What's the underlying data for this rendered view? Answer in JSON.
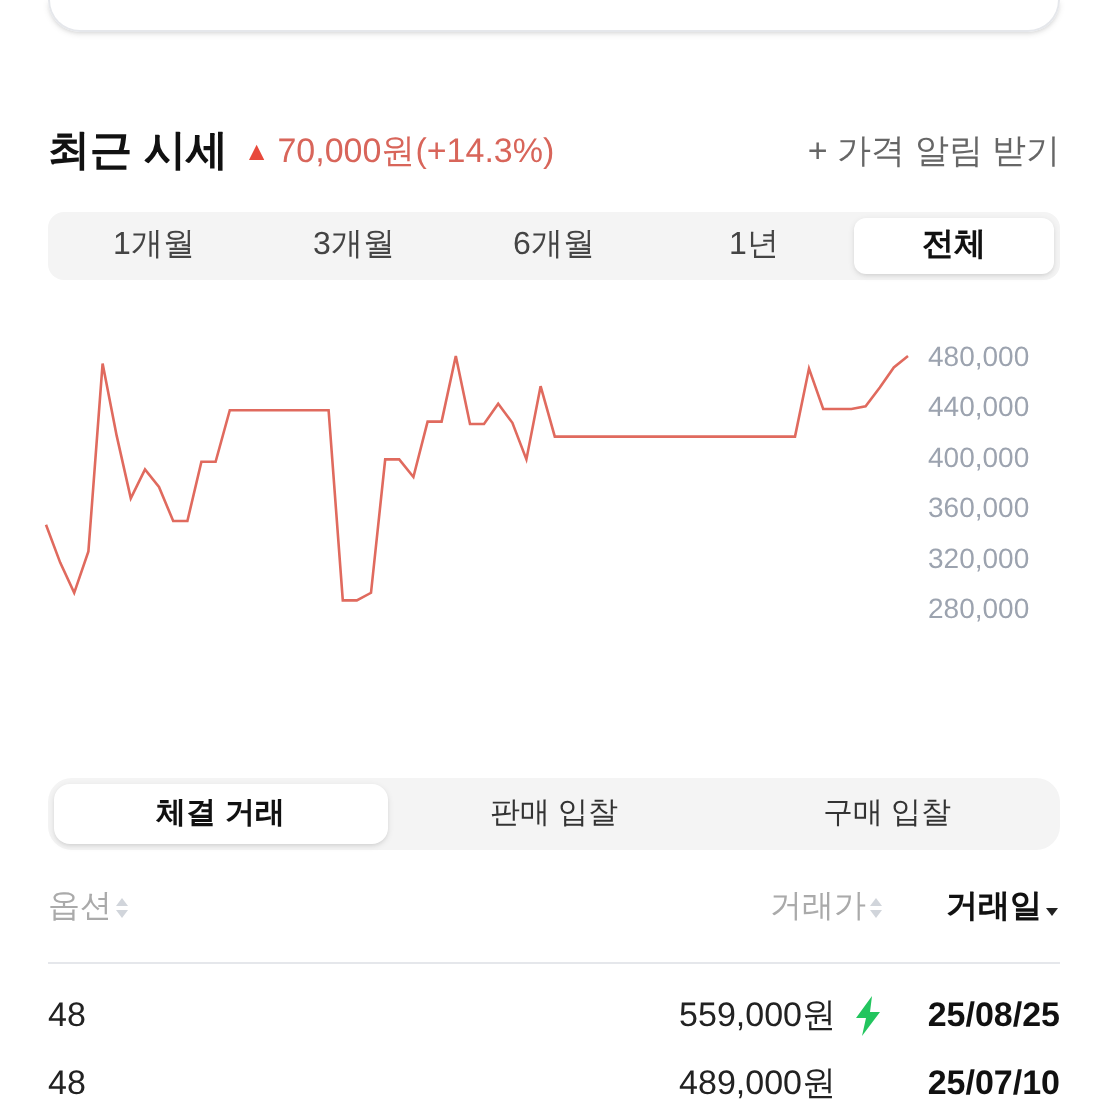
{
  "section": {
    "title": "최근 시세",
    "trend_marker": "▲",
    "change": "70,000원(+14.3%)",
    "alert_link": "+ 가격 알림 받기"
  },
  "period_tabs": [
    {
      "label": "1개월",
      "selected": false
    },
    {
      "label": "3개월",
      "selected": false
    },
    {
      "label": "6개월",
      "selected": false
    },
    {
      "label": "1년",
      "selected": false
    },
    {
      "label": "전체",
      "selected": true
    }
  ],
  "chart_data": {
    "type": "line",
    "ylim": [
      280000,
      480000
    ],
    "yticks": [
      {
        "value": 480000,
        "label": "480,000"
      },
      {
        "value": 440000,
        "label": "440,000"
      },
      {
        "value": 400000,
        "label": "400,000"
      },
      {
        "value": 360000,
        "label": "360,000"
      },
      {
        "value": 320000,
        "label": "320,000"
      },
      {
        "value": 280000,
        "label": "280,000"
      }
    ],
    "categories": [
      null,
      null,
      null,
      null,
      null,
      null,
      null,
      null,
      null,
      null,
      null,
      null,
      null,
      null,
      null,
      null,
      null,
      null,
      null,
      null,
      null,
      null,
      null,
      null,
      null,
      null,
      null,
      null,
      null,
      null,
      null,
      null,
      null,
      null,
      null,
      null,
      null,
      null,
      null,
      null,
      null,
      null,
      null,
      null,
      null,
      null,
      null,
      null,
      null,
      null,
      null,
      null,
      null,
      null,
      null,
      null,
      null,
      null,
      null,
      null,
      null,
      null
    ],
    "series": [
      {
        "color": "#e06a5e",
        "values": [
          346000,
          316000,
          292000,
          325000,
          474000,
          417000,
          367000,
          390000,
          376000,
          349000,
          349000,
          396000,
          396000,
          437000,
          437000,
          437000,
          437000,
          437000,
          437000,
          437000,
          437000,
          286000,
          286000,
          292000,
          398000,
          398000,
          384000,
          428000,
          428000,
          480000,
          426000,
          426000,
          442000,
          427000,
          398000,
          456000,
          416000,
          416000,
          416000,
          416000,
          416000,
          416000,
          416000,
          416000,
          416000,
          416000,
          416000,
          416000,
          416000,
          416000,
          416000,
          416000,
          416000,
          416000,
          470000,
          438000,
          438000,
          438000,
          440000,
          455000,
          471000,
          480000
        ]
      }
    ]
  },
  "trade_tabs": [
    {
      "label": "체결 거래",
      "selected": true
    },
    {
      "label": "판매 입찰",
      "selected": false
    },
    {
      "label": "구매 입찰",
      "selected": false
    }
  ],
  "table": {
    "columns": [
      {
        "label": "옵션",
        "sorted": false
      },
      {
        "label": "거래가",
        "sorted": false
      },
      {
        "label": "거래일",
        "sorted": true
      }
    ],
    "rows": [
      {
        "option": "48",
        "price": "559,000원",
        "quick": true,
        "date": "25/08/25"
      },
      {
        "option": "48",
        "price": "489,000원",
        "quick": false,
        "date": "25/07/10"
      }
    ]
  }
}
